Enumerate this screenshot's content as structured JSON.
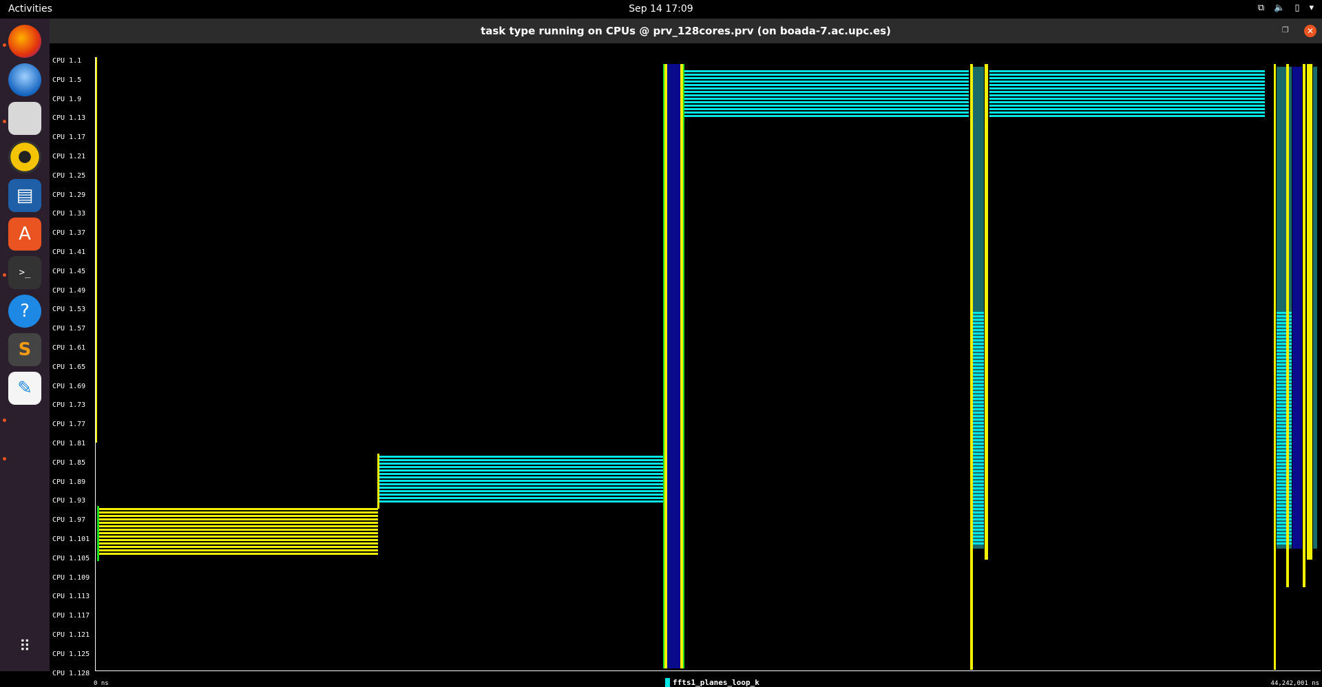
{
  "topbar": {
    "activities": "Activities",
    "clock": "Sep 14  17:09"
  },
  "dock": {
    "apps": [
      "firefox-icon",
      "thunderbird-icon",
      "files-icon",
      "rhythmbox-icon",
      "writer-icon",
      "software-icon",
      "terminal-icon",
      "help-icon",
      "sublime-icon",
      "text-editor-icon",
      "show-apps-icon"
    ]
  },
  "window": {
    "title": "task type running on CPUs @ prv_128cores.prv (on boada-7.ac.upc.es)"
  },
  "paraver": {
    "cpu_labels": [
      "CPU 1.1",
      "CPU 1.5",
      "CPU 1.9",
      "CPU 1.13",
      "CPU 1.17",
      "CPU 1.21",
      "CPU 1.25",
      "CPU 1.29",
      "CPU 1.33",
      "CPU 1.37",
      "CPU 1.41",
      "CPU 1.45",
      "CPU 1.49",
      "CPU 1.53",
      "CPU 1.57",
      "CPU 1.61",
      "CPU 1.65",
      "CPU 1.69",
      "CPU 1.73",
      "CPU 1.77",
      "CPU 1.81",
      "CPU 1.85",
      "CPU 1.89",
      "CPU 1.93",
      "CPU 1.97",
      "CPU 1.101",
      "CPU 1.105",
      "CPU 1.109",
      "CPU 1.113",
      "CPU 1.117",
      "CPU 1.121",
      "CPU 1.125",
      "CPU 1.128"
    ],
    "time_start": "0 ns",
    "time_end": "44,242,001 ns",
    "legend": {
      "label": "ffts1_planes_loop_k",
      "color": "#00e5e5"
    },
    "colors": {
      "cyan": "#00e5e5",
      "yellow": "#f2f200",
      "blue": "#0a0a8c",
      "green": "#22dd22"
    }
  }
}
